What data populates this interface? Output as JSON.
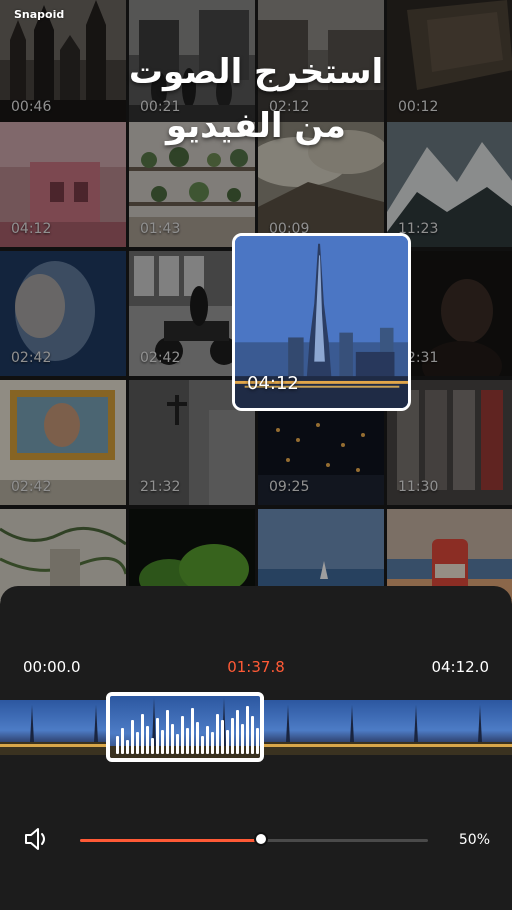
{
  "app": {
    "brand": "Snapoid",
    "headline_line1": "استخرج الصوت",
    "headline_line2": "من الفيديو",
    "accent": "#ff5a36"
  },
  "grid": {
    "tiles": [
      {
        "duration": "00:46",
        "scene": "gothic-city"
      },
      {
        "duration": "00:21",
        "scene": "street-people"
      },
      {
        "duration": "02:12",
        "scene": "city-square"
      },
      {
        "duration": "00:12",
        "scene": "paper-dark"
      },
      {
        "duration": "04:12",
        "scene": "pink-building"
      },
      {
        "duration": "01:43",
        "scene": "plant-shelf"
      },
      {
        "duration": "00:09",
        "scene": "desert-clouds"
      },
      {
        "duration": "11:23",
        "scene": "snowy-peak"
      },
      {
        "duration": "02:42",
        "scene": "motion-portrait"
      },
      {
        "duration": "02:42",
        "scene": "motorbike"
      },
      {
        "duration": "",
        "scene": "hidden"
      },
      {
        "duration": "02:31",
        "scene": "dark-portrait"
      },
      {
        "duration": "02:42",
        "scene": "mosaic-wall"
      },
      {
        "duration": "21:32",
        "scene": "concrete-cross"
      },
      {
        "duration": "09:25",
        "scene": "night-city"
      },
      {
        "duration": "11:30",
        "scene": "shutters"
      },
      {
        "duration": "",
        "scene": "ivy-wall"
      },
      {
        "duration": "",
        "scene": "green-trees"
      },
      {
        "duration": "",
        "scene": "sea-sailboat"
      },
      {
        "duration": "",
        "scene": "soda-can"
      }
    ]
  },
  "featured": {
    "duration": "04:12",
    "scene": "burj-khalifa-dusk"
  },
  "editor": {
    "time_start": "00:00.0",
    "time_current": "01:37.8",
    "time_end": "04:12.0",
    "volume_label": "50%",
    "volume_level": 0.52,
    "volume_icon": "speaker-icon"
  }
}
